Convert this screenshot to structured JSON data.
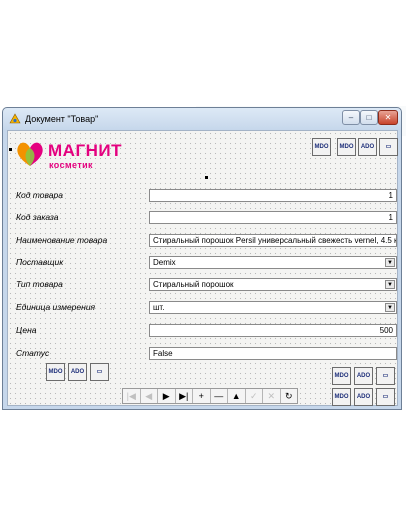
{
  "window": {
    "title": "Документ \"Товар\"",
    "controls": {
      "minimize": "–",
      "maximize": "□",
      "close": "✕"
    }
  },
  "logo": {
    "word": "МАГНИТ",
    "sub": "косметик"
  },
  "icons": {
    "mdo": "MDO",
    "ado": "ADO"
  },
  "form": {
    "fields": [
      {
        "label": "Код товара",
        "value": "1",
        "kind": "number"
      },
      {
        "label": "Код заказа",
        "value": "1",
        "kind": "number"
      },
      {
        "label": "Наименование товара",
        "value": "Стиральный порошок Persil универсальный свежесть vernel, 4.5 кг",
        "kind": "text"
      },
      {
        "label": "Поставщик",
        "value": "Demix",
        "kind": "combo"
      },
      {
        "label": "Тип товара",
        "value": "Стиральный порошок",
        "kind": "combo"
      },
      {
        "label": "Единица измерения",
        "value": "шт.",
        "kind": "combo"
      },
      {
        "label": "Цена",
        "value": "500",
        "kind": "number"
      },
      {
        "label": "Статус",
        "value": "False",
        "kind": "text"
      }
    ]
  },
  "navigator": {
    "buttons": [
      {
        "glyph": "|◀",
        "name": "first",
        "enabled": false
      },
      {
        "glyph": "◀",
        "name": "prior",
        "enabled": false
      },
      {
        "glyph": "▶",
        "name": "next",
        "enabled": true
      },
      {
        "glyph": "▶|",
        "name": "last",
        "enabled": true
      },
      {
        "glyph": "+",
        "name": "insert",
        "enabled": true
      },
      {
        "glyph": "—",
        "name": "delete",
        "enabled": true
      },
      {
        "glyph": "▲",
        "name": "edit",
        "enabled": true
      },
      {
        "glyph": "✓",
        "name": "post",
        "enabled": false
      },
      {
        "glyph": "✕",
        "name": "cancel",
        "enabled": false
      },
      {
        "glyph": "↻",
        "name": "refresh",
        "enabled": true
      }
    ]
  },
  "colors": {
    "brand": "#e4007f",
    "leaf_orange": "#f39200",
    "leaf_green": "#8cc63f"
  }
}
